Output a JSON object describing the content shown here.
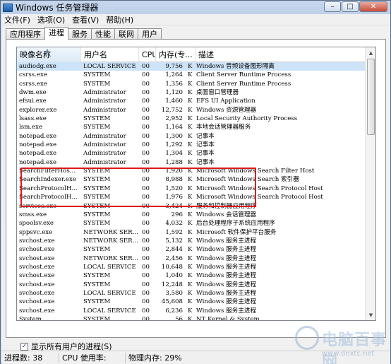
{
  "window": {
    "title": "Windows 任务管理器",
    "minimize": "–",
    "maximize": "□",
    "close": "✕"
  },
  "menu": [
    "文件(F)",
    "选项(O)",
    "查看(V)",
    "帮助(H)"
  ],
  "tabs": [
    "应用程序",
    "进程",
    "服务",
    "性能",
    "联网",
    "用户"
  ],
  "active_tab": "进程",
  "columns": {
    "name": "映像名称",
    "user": "用户名",
    "cpu": "CPU",
    "mem": "内存(专...",
    "desc": "描述"
  },
  "rows": [
    {
      "name": "audiodg.exe",
      "user": "LOCAL SERVICE",
      "cpu": "00",
      "mem": "9,756",
      "unit": "K",
      "desc": "Windows 音频设备图形隔离"
    },
    {
      "name": "csrss.exe",
      "user": "SYSTEM",
      "cpu": "00",
      "mem": "1,264",
      "unit": "K",
      "desc": "Client Server Runtime Process"
    },
    {
      "name": "csrss.exe",
      "user": "SYSTEM",
      "cpu": "00",
      "mem": "1,356",
      "unit": "K",
      "desc": "Client Server Runtime Process"
    },
    {
      "name": "dwm.exe",
      "user": "Administrator",
      "cpu": "00",
      "mem": "1,120",
      "unit": "K",
      "desc": "桌面窗口管理器"
    },
    {
      "name": "efsui.exe",
      "user": "Administrator",
      "cpu": "00",
      "mem": "1,460",
      "unit": "K",
      "desc": "EFS UI Application"
    },
    {
      "name": "explorer.exe",
      "user": "Administrator",
      "cpu": "00",
      "mem": "12,752",
      "unit": "K",
      "desc": "Windows 资源管理器"
    },
    {
      "name": "lsass.exe",
      "user": "SYSTEM",
      "cpu": "00",
      "mem": "2,952",
      "unit": "K",
      "desc": "Local Security Authority Process"
    },
    {
      "name": "lsm.exe",
      "user": "SYSTEM",
      "cpu": "00",
      "mem": "1,164",
      "unit": "K",
      "desc": "本地会话管理器服务"
    },
    {
      "name": "notepad.exe",
      "user": "Administrator",
      "cpu": "00",
      "mem": "1,300",
      "unit": "K",
      "desc": "记事本"
    },
    {
      "name": "notepad.exe",
      "user": "Administrator",
      "cpu": "00",
      "mem": "1,292",
      "unit": "K",
      "desc": "记事本"
    },
    {
      "name": "notepad.exe",
      "user": "Administrator",
      "cpu": "00",
      "mem": "1,304",
      "unit": "K",
      "desc": "记事本"
    },
    {
      "name": "notepad.exe",
      "user": "Administrator",
      "cpu": "00",
      "mem": "1,288",
      "unit": "K",
      "desc": "记事本"
    },
    {
      "name": "SearchFilterHos...",
      "user": "SYSTEM",
      "cpu": "00",
      "mem": "1,920",
      "unit": "K",
      "desc": "Microsoft Windows Search Filter Host"
    },
    {
      "name": "SearchIndexer.exe",
      "user": "SYSTEM",
      "cpu": "00",
      "mem": "8,988",
      "unit": "K",
      "desc": "Microsoft Windows Search 索引器"
    },
    {
      "name": "SearchProtocolH...",
      "user": "SYSTEM",
      "cpu": "00",
      "mem": "1,520",
      "unit": "K",
      "desc": "Microsoft Windows Search Protocol Host"
    },
    {
      "name": "SearchProtocolH...",
      "user": "SYSTEM",
      "cpu": "00",
      "mem": "1,976",
      "unit": "K",
      "desc": "Microsoft Windows Search Protocol Host"
    },
    {
      "name": "services.exe",
      "user": "SYSTEM",
      "cpu": "00",
      "mem": "3,424",
      "unit": "K",
      "desc": "服务和控制器应用程序"
    },
    {
      "name": "smss.exe",
      "user": "SYSTEM",
      "cpu": "00",
      "mem": "296",
      "unit": "K",
      "desc": "Windows 会话管理器"
    },
    {
      "name": "spoolsv.exe",
      "user": "SYSTEM",
      "cpu": "00",
      "mem": "4,032",
      "unit": "K",
      "desc": "后台处理程序子系统应用程序"
    },
    {
      "name": "sppsvc.exe",
      "user": "NETWORK SER...",
      "cpu": "00",
      "mem": "1,592",
      "unit": "K",
      "desc": "Microsoft 软件保护平台服务"
    },
    {
      "name": "svchost.exe",
      "user": "NETWORK SER...",
      "cpu": "00",
      "mem": "5,132",
      "unit": "K",
      "desc": "Windows 服务主进程"
    },
    {
      "name": "svchost.exe",
      "user": "SYSTEM",
      "cpu": "00",
      "mem": "2,844",
      "unit": "K",
      "desc": "Windows 服务主进程"
    },
    {
      "name": "svchost.exe",
      "user": "NETWORK SER...",
      "cpu": "00",
      "mem": "2,456",
      "unit": "K",
      "desc": "Windows 服务主进程"
    },
    {
      "name": "svchost.exe",
      "user": "LOCAL SERVICE",
      "cpu": "00",
      "mem": "10,648",
      "unit": "K",
      "desc": "Windows 服务主进程"
    },
    {
      "name": "svchost.exe",
      "user": "SYSTEM",
      "cpu": "00",
      "mem": "1,040",
      "unit": "K",
      "desc": "Windows 服务主进程"
    },
    {
      "name": "svchost.exe",
      "user": "SYSTEM",
      "cpu": "00",
      "mem": "12,248",
      "unit": "K",
      "desc": "Windows 服务主进程"
    },
    {
      "name": "svchost.exe",
      "user": "LOCAL SERVICE",
      "cpu": "00",
      "mem": "3,580",
      "unit": "K",
      "desc": "Windows 服务主进程"
    },
    {
      "name": "svchost.exe",
      "user": "SYSTEM",
      "cpu": "00",
      "mem": "45,608",
      "unit": "K",
      "desc": "Windows 服务主进程"
    },
    {
      "name": "svchost.exe",
      "user": "LOCAL SERVICE",
      "cpu": "00",
      "mem": "6,236",
      "unit": "K",
      "desc": "Windows 服务主进程"
    },
    {
      "name": "System",
      "user": "SYSTEM",
      "cpu": "00",
      "mem": "56",
      "unit": "K",
      "desc": "NT Kernel & System"
    }
  ],
  "show_all_users": "显示所有用户的进程(S)",
  "end_process": "结束进程(E)",
  "status": {
    "processes": "进程数: 38",
    "cpu": "CPU 使用率: 0%",
    "memory": "物理内存: 29%"
  },
  "watermark": {
    "text": "电脑百事网",
    "url": "www.dnxtc.net"
  },
  "colors": {
    "highlight_border": "#e0161a"
  }
}
